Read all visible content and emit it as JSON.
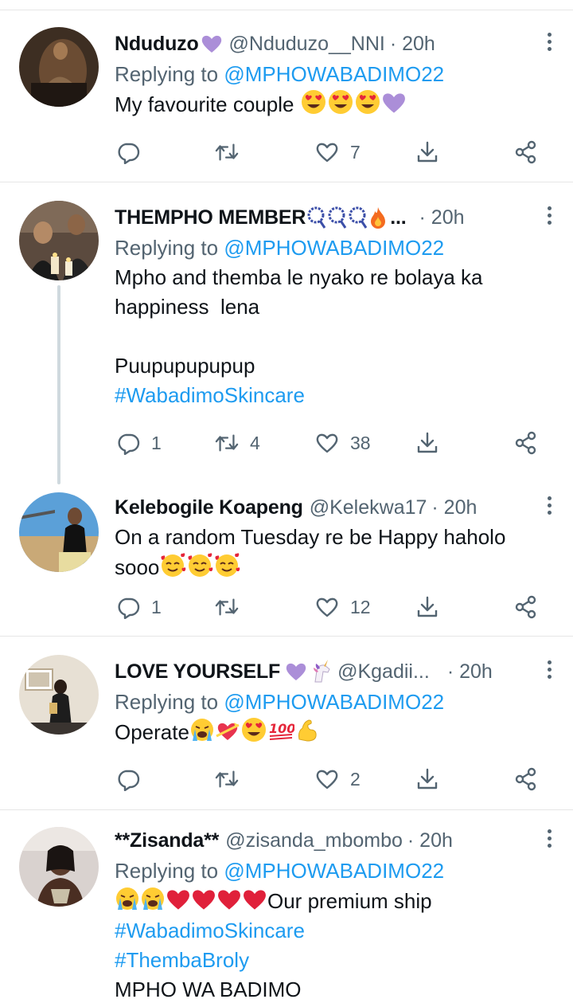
{
  "tweets": [
    {
      "name": "Nduduzo",
      "name_emoji": [
        "purple-heart"
      ],
      "handle": "@Nduduzo__NNI",
      "time": "· 20h",
      "replying_prefix": "Replying to",
      "replying_to": "@MPHOWABADIMO22",
      "lines": [
        {
          "text": "My favourite couple",
          "emoji": [
            "heart-eyes",
            "heart-eyes",
            "heart-eyes",
            "purple-heart"
          ]
        }
      ],
      "counts": {
        "replies": "",
        "retweets": "",
        "likes": "7"
      }
    },
    {
      "name": "THEMPHO MEMBER",
      "name_emoji": [
        "prayer-beads",
        "prayer-beads",
        "prayer-beads",
        "fire"
      ],
      "name_suffix": "...",
      "handle": "",
      "time": "· 20h",
      "replying_prefix": "Replying to",
      "replying_to": "@MPHOWABADIMO22",
      "lines": [
        {
          "text": "Mpho and themba le nyako re bolaya ka"
        },
        {
          "text": "happiness  lena"
        },
        {
          "text": ""
        },
        {
          "text": "Puupupupupup"
        },
        {
          "text": "#WabadimoSkincare",
          "hashtag": true
        }
      ],
      "counts": {
        "replies": "1",
        "retweets": "4",
        "likes": "38"
      }
    },
    {
      "name": "Kelebogile Koapeng",
      "handle": "@Kelekwa17",
      "time": "· 20h",
      "lines": [
        {
          "text": "On a random Tuesday re be Happy haholo"
        },
        {
          "text": "sooo",
          "emoji": [
            "smiling-hearts",
            "smiling-hearts",
            "smiling-hearts"
          ]
        }
      ],
      "counts": {
        "replies": "1",
        "retweets": "",
        "likes": "12"
      }
    },
    {
      "name": "LOVE YOURSELF",
      "name_emoji": [
        "purple-heart",
        "unicorn"
      ],
      "handle": "@Kgadii...",
      "time": "· 20h",
      "replying_prefix": "Replying to",
      "replying_to": "@MPHOWABADIMO22",
      "lines": [
        {
          "text": "Operate",
          "emoji": [
            "loudly-crying",
            "heart-ribbon",
            "heart-eyes",
            "hundred",
            "flexed-bicep"
          ]
        }
      ],
      "counts": {
        "replies": "",
        "retweets": "",
        "likes": "2"
      }
    },
    {
      "name": "**Zisanda**",
      "handle": "@zisanda_mbombo",
      "time": "· 20h",
      "replying_prefix": "Replying to",
      "replying_to": "@MPHOWABADIMO22",
      "lines": [
        {
          "text": "Our premium ship",
          "emoji_before": [
            "loudly-crying",
            "loudly-crying",
            "red-heart",
            "red-heart",
            "red-heart",
            "red-heart"
          ]
        },
        {
          "text": "#WabadimoSkincare",
          "hashtag": true
        },
        {
          "text": "#ThembaBroly",
          "hashtag": true
        },
        {
          "text": "MPHO WA BADIMO"
        }
      ],
      "counts": {
        "replies": "",
        "retweets": "",
        "likes": ""
      }
    }
  ],
  "icons": [
    "reply-icon",
    "retweet-icon",
    "like-icon",
    "download-icon",
    "share-icon",
    "more-icon"
  ],
  "colors": {
    "link": "#1d9bf0",
    "secondary": "#536471",
    "text": "#0f1419",
    "divider": "#e6e6e6"
  }
}
